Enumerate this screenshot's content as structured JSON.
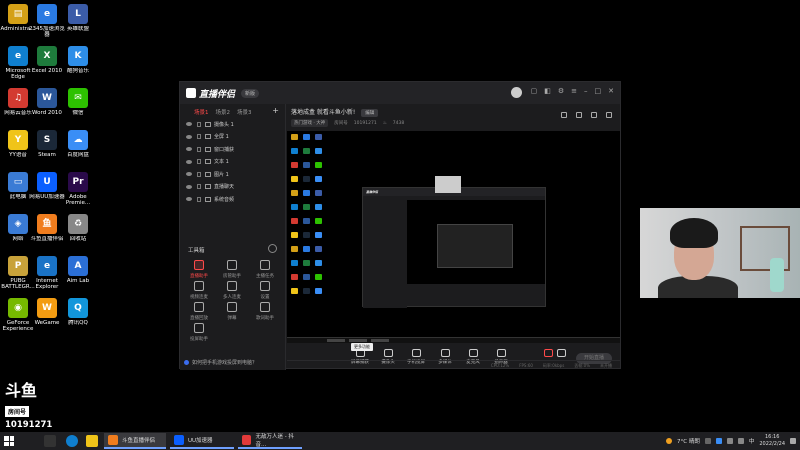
{
  "desktop": {
    "icons": [
      {
        "label": "Administra...",
        "color": "#d4a017",
        "glyph": "▤"
      },
      {
        "label": "2345加速浏览器",
        "color": "#2a7ae2",
        "glyph": "e"
      },
      {
        "label": "英雄联盟",
        "color": "#3b5ca8",
        "glyph": "L"
      },
      {
        "label": "Microsoft Edge",
        "color": "#0f7fcf",
        "glyph": "e"
      },
      {
        "label": "Excel 2010",
        "color": "#1e7b3c",
        "glyph": "X"
      },
      {
        "label": "酷狗音乐",
        "color": "#2e8ee8",
        "glyph": "K"
      },
      {
        "label": "网易云音乐",
        "color": "#d33a31",
        "glyph": "♫"
      },
      {
        "label": "Word 2010",
        "color": "#2b579a",
        "glyph": "W"
      },
      {
        "label": "微信",
        "color": "#2dc100",
        "glyph": "✉"
      },
      {
        "label": "YY语音",
        "color": "#f0c419",
        "glyph": "Y"
      },
      {
        "label": "Steam",
        "color": "#1b2838",
        "glyph": "S"
      },
      {
        "label": "百度网盘",
        "color": "#3a8ef6",
        "glyph": "☁"
      },
      {
        "label": "此电脑",
        "color": "#3a7bd5",
        "glyph": "▭"
      },
      {
        "label": "网易UU加速器",
        "color": "#0b5fff",
        "glyph": "U"
      },
      {
        "label": "Adobe Premie...",
        "color": "#2a0a4a",
        "glyph": "Pr"
      },
      {
        "label": "网络",
        "color": "#3a7bd5",
        "glyph": "◈"
      },
      {
        "label": "斗鱼直播伴侣",
        "color": "#f07d1e",
        "glyph": "鱼"
      },
      {
        "label": "回收站",
        "color": "#888888",
        "glyph": "♻"
      },
      {
        "label": "PUBG BATTLEGR...",
        "color": "#c8a23a",
        "glyph": "P"
      },
      {
        "label": "Internet Explorer",
        "color": "#1a73c6",
        "glyph": "e"
      },
      {
        "label": "Aim Lab",
        "color": "#2b6fd6",
        "glyph": "A"
      },
      {
        "label": "GeForce Experience",
        "color": "#76b900",
        "glyph": "◉"
      },
      {
        "label": "WeGame",
        "color": "#f39c12",
        "glyph": "W"
      },
      {
        "label": "腾讯QQ",
        "color": "#1296db",
        "glyph": "Q"
      }
    ]
  },
  "app": {
    "logo_text": "直播伴侣",
    "version_badge": "新版",
    "sidebar_tabs": [
      "场景1",
      "场景2",
      "场景3"
    ],
    "sidebar_add": "+",
    "sources": [
      "摄像头 1",
      "全屏 1",
      "窗口捕获",
      "文本 1",
      "图片 1",
      "直播聊天",
      "系统音频"
    ],
    "tools_title": "工具箱",
    "tools": [
      {
        "label": "直播助手",
        "red": true
      },
      {
        "label": "房管助手",
        "red": false
      },
      {
        "label": "主播任务",
        "red": false
      },
      {
        "label": "视频连麦",
        "red": false
      },
      {
        "label": "多人连麦",
        "red": false
      },
      {
        "label": "设置",
        "red": false
      },
      {
        "label": "直播回放",
        "red": false
      },
      {
        "label": "弹幕",
        "red": false
      },
      {
        "label": "歌词助手",
        "red": false
      },
      {
        "label": "投屏助手",
        "red": false
      }
    ],
    "footer_notice": "如何把手机游戏投屏到电脑？",
    "room_title": "落地成盒 就看斗鱼小新!",
    "room_tag": "编辑",
    "room_category": "热门游戏 · 大神",
    "room_id_label": "房间号",
    "room_id": "10191271",
    "room_hot": "7438",
    "bottom_tools": [
      "屏幕捕获",
      "摄像头",
      "手机投屏",
      "多媒体",
      "麦克风",
      "扬声器"
    ],
    "live_button": "开始直播",
    "tooltip": "更多功能",
    "status_items": [
      "CPU:12%",
      "FPS:60",
      "码率:0kbps",
      "丢帧:0%",
      "未开播"
    ]
  },
  "watermark": {
    "big": "斗鱼",
    "sub": "房间号",
    "room_number": "10191271"
  },
  "taskbar": {
    "tasks": [
      {
        "label": "斗鱼直播伴侣",
        "color": "#f07d1e",
        "active": true
      },
      {
        "label": "UU加速器",
        "color": "#0b5fff",
        "active": false
      },
      {
        "label": "无敌万人迷 - 抖音...",
        "color": "#e23a3a",
        "active": false
      }
    ],
    "weather": "7°C 晴朗",
    "time": "16:16",
    "date": "2022/2/24"
  }
}
